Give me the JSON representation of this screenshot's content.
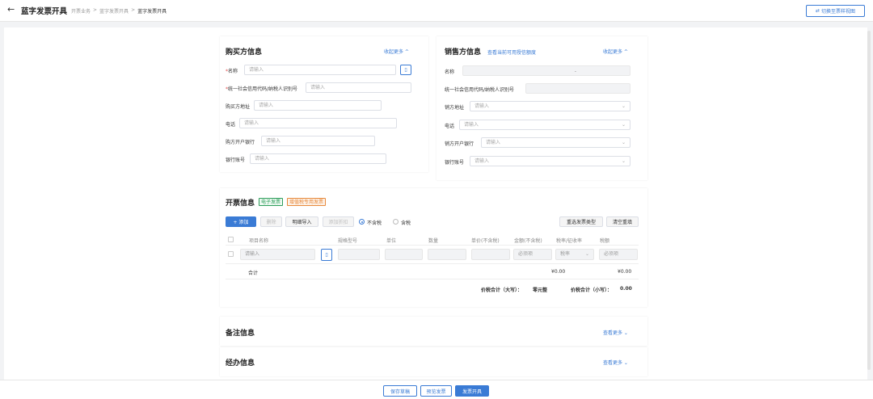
{
  "header": {
    "back_icon": "←",
    "title": "蓝字发票开具",
    "breadcrumb": [
      "开票业务",
      "蓝字发票开具",
      "蓝字发票开具"
    ],
    "separator": ">",
    "switch_label": "切换至票样视图",
    "switch_icon": "⇄"
  },
  "buyer": {
    "title": "购买方信息",
    "collapse": "收起更多 ^",
    "fields": [
      {
        "label": "名称",
        "required": "*",
        "placeholder": "请输入"
      },
      {
        "label": "统一社会信用代码/纳税人识别号",
        "required": "*",
        "placeholder": "请输入"
      },
      {
        "label": "购买方地址",
        "placeholder": "请输入"
      },
      {
        "label": "电话",
        "placeholder": "请输入"
      },
      {
        "label": "购方开户银行",
        "placeholder": "请输入"
      },
      {
        "label": "银行账号",
        "placeholder": "请输入"
      }
    ]
  },
  "seller": {
    "title": "销售方信息",
    "quota_link": "查看当前可用授信额度",
    "collapse": "收起更多 ^",
    "fields": [
      {
        "label": "名称",
        "value": "",
        "extra": "."
      },
      {
        "label": "统一社会信用代码/纳税人识别号",
        "value": ""
      },
      {
        "label": "销方地址",
        "placeholder": "请输入"
      },
      {
        "label": "电话",
        "placeholder": "请输入"
      },
      {
        "label": "销方开户银行",
        "placeholder": "请输入"
      },
      {
        "label": "银行账号",
        "placeholder": "请输入"
      }
    ]
  },
  "invoice": {
    "title": "开票信息",
    "tag1": "电子发票",
    "tag2": "增值税专用发票",
    "buttons": {
      "add": "+ 添加",
      "delete": "删除",
      "import": "明细导入",
      "add_discount": "添加折扣",
      "reselect": "重选发票类型",
      "clear": "清空重填"
    },
    "tax_options": [
      "不含税",
      "含税"
    ],
    "columns": [
      "项目名称",
      "规格型号",
      "单位",
      "数量",
      "单价(不含税)",
      "金额(不含税)",
      "税率/征收率",
      "税额"
    ],
    "row": {
      "name_placeholder": "请输入",
      "amount_placeholder": "必须项",
      "tax_rate_placeholder": "税率",
      "tax_placeholder": "必须项"
    },
    "total_label": "合计",
    "total_amount": "¥0.00",
    "total_tax": "¥0.00",
    "total_upper_label": "价税合计（大写）：",
    "total_upper": "零元整",
    "total_lower_label": "价税合计（小写）：",
    "total_lower": "0.00"
  },
  "remarks": {
    "title": "备注信息",
    "more": "查看更多 ⌄"
  },
  "handler": {
    "title": "经办信息",
    "more": "查看更多 ⌄"
  },
  "footer": {
    "save": "保存草稿",
    "preview": "预览发票",
    "issue": "发票开具"
  }
}
